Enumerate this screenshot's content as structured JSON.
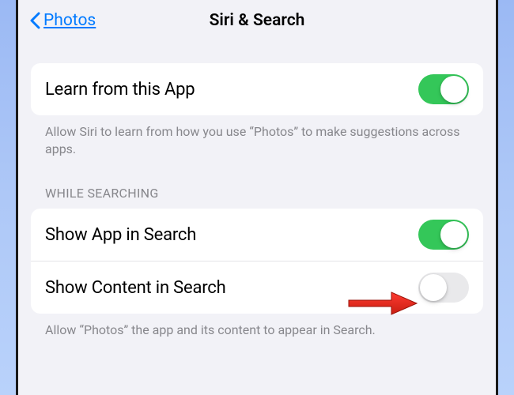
{
  "nav": {
    "back_label": "Photos",
    "title": "Siri & Search"
  },
  "section1": {
    "rows": [
      {
        "label": "Learn from this App",
        "on": true
      }
    ],
    "footer": "Allow Siri to learn from how you use “Photos” to make suggestions across apps."
  },
  "section2": {
    "header": "WHILE SEARCHING",
    "rows": [
      {
        "label": "Show App in Search",
        "on": true
      },
      {
        "label": "Show Content in Search",
        "on": false
      }
    ],
    "footer": "Allow “Photos” the app and its content to appear in Search."
  },
  "colors": {
    "accent": "#007aff",
    "toggle_on": "#34c759"
  }
}
